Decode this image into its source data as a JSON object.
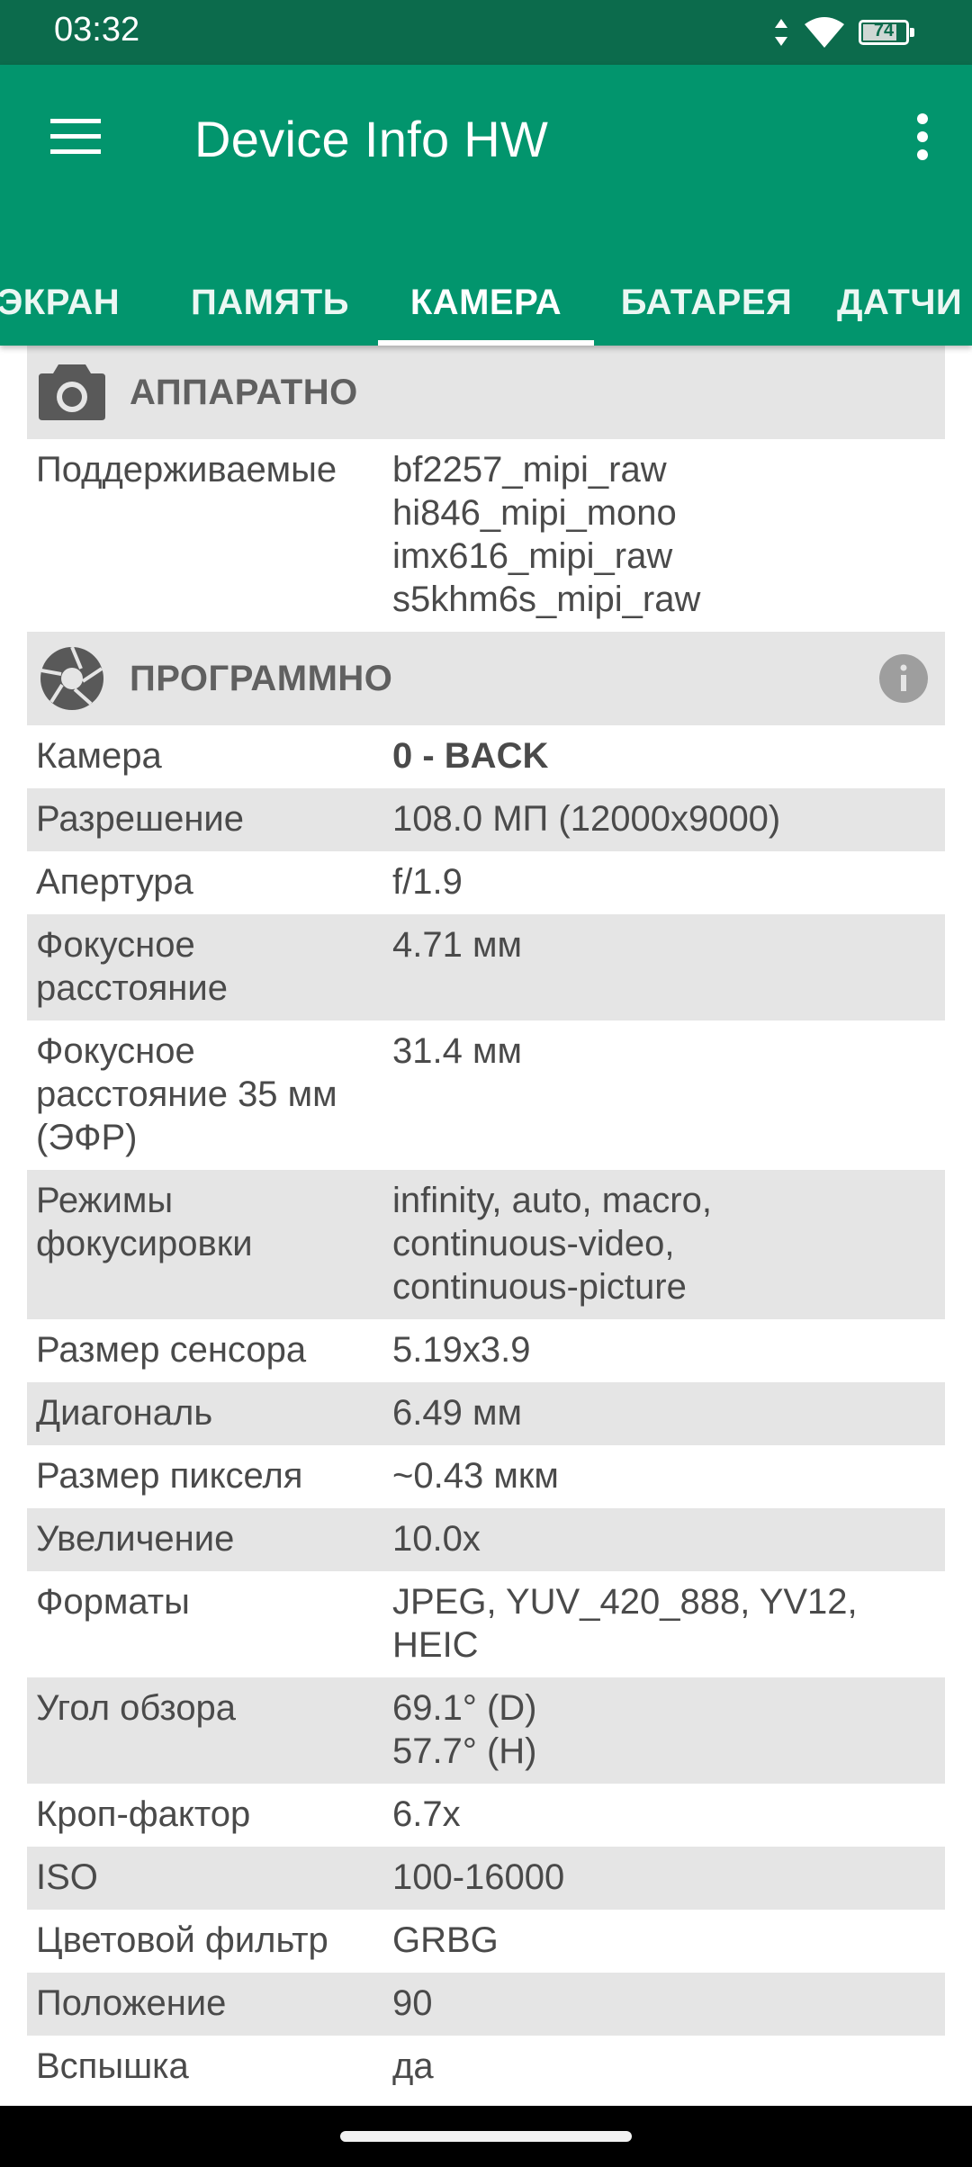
{
  "status_bar": {
    "time": "03:32",
    "battery_level": "74",
    "battery_fraction": 0.74,
    "icons": [
      "data-arrows-icon",
      "wifi-icon",
      "battery-icon"
    ]
  },
  "app_bar": {
    "title": "Device Info HW",
    "color": "#02956d",
    "status_color": "#0c6b4c"
  },
  "tabs": [
    {
      "label": "ЭКРАН"
    },
    {
      "label": "ПАМЯТЬ"
    },
    {
      "label": "КАМЕРА",
      "active": true
    },
    {
      "label": "БАТАРЕЯ"
    },
    {
      "label": "ДАТЧИ"
    }
  ],
  "hardware_section": {
    "title": "АППАРАТНО",
    "icon": "camera-icon",
    "supported_label": "Поддерживаемые",
    "supported_value": "bf2257_mipi_raw\nhi846_mipi_mono\nimx616_mipi_raw\ns5khm6s_mipi_raw"
  },
  "software_section": {
    "title": "ПРОГРАММНО",
    "icon": "aperture-icon",
    "info_icon": "info-icon",
    "rows": [
      {
        "label": "Камера",
        "value": "0 - BACK"
      },
      {
        "label": "Разрешение",
        "value": "108.0 МП (12000x9000)"
      },
      {
        "label": "Апертура",
        "value": "f/1.9"
      },
      {
        "label": "Фокусное\nрасстояние",
        "value": "4.71 мм"
      },
      {
        "label": "Фокусное\nрасстояние 35 мм\n(ЭФР)",
        "value": "31.4 мм"
      },
      {
        "label": "Режимы\nфокусировки",
        "value": "infinity, auto, macro,\ncontinuous-video,\ncontinuous-picture"
      },
      {
        "label": "Размер сенсора",
        "value": "5.19x3.9"
      },
      {
        "label": "Диагональ",
        "value": "6.49 мм"
      },
      {
        "label": "Размер пикселя",
        "value": "~0.43 мкм"
      },
      {
        "label": "Увеличение",
        "value": "10.0x"
      },
      {
        "label": "Форматы",
        "value": "JPEG, YUV_420_888, YV12,\nHEIC"
      },
      {
        "label": "Угол обзора",
        "value": "69.1° (D)\n57.7° (H)"
      },
      {
        "label": "Кроп-фактор",
        "value": "6.7x"
      },
      {
        "label": "ISO",
        "value": "100-16000"
      },
      {
        "label": "Цветовой фильтр",
        "value": "GRBG"
      },
      {
        "label": "Положение",
        "value": "90"
      },
      {
        "label": "Вспышка",
        "value": "да"
      }
    ]
  }
}
